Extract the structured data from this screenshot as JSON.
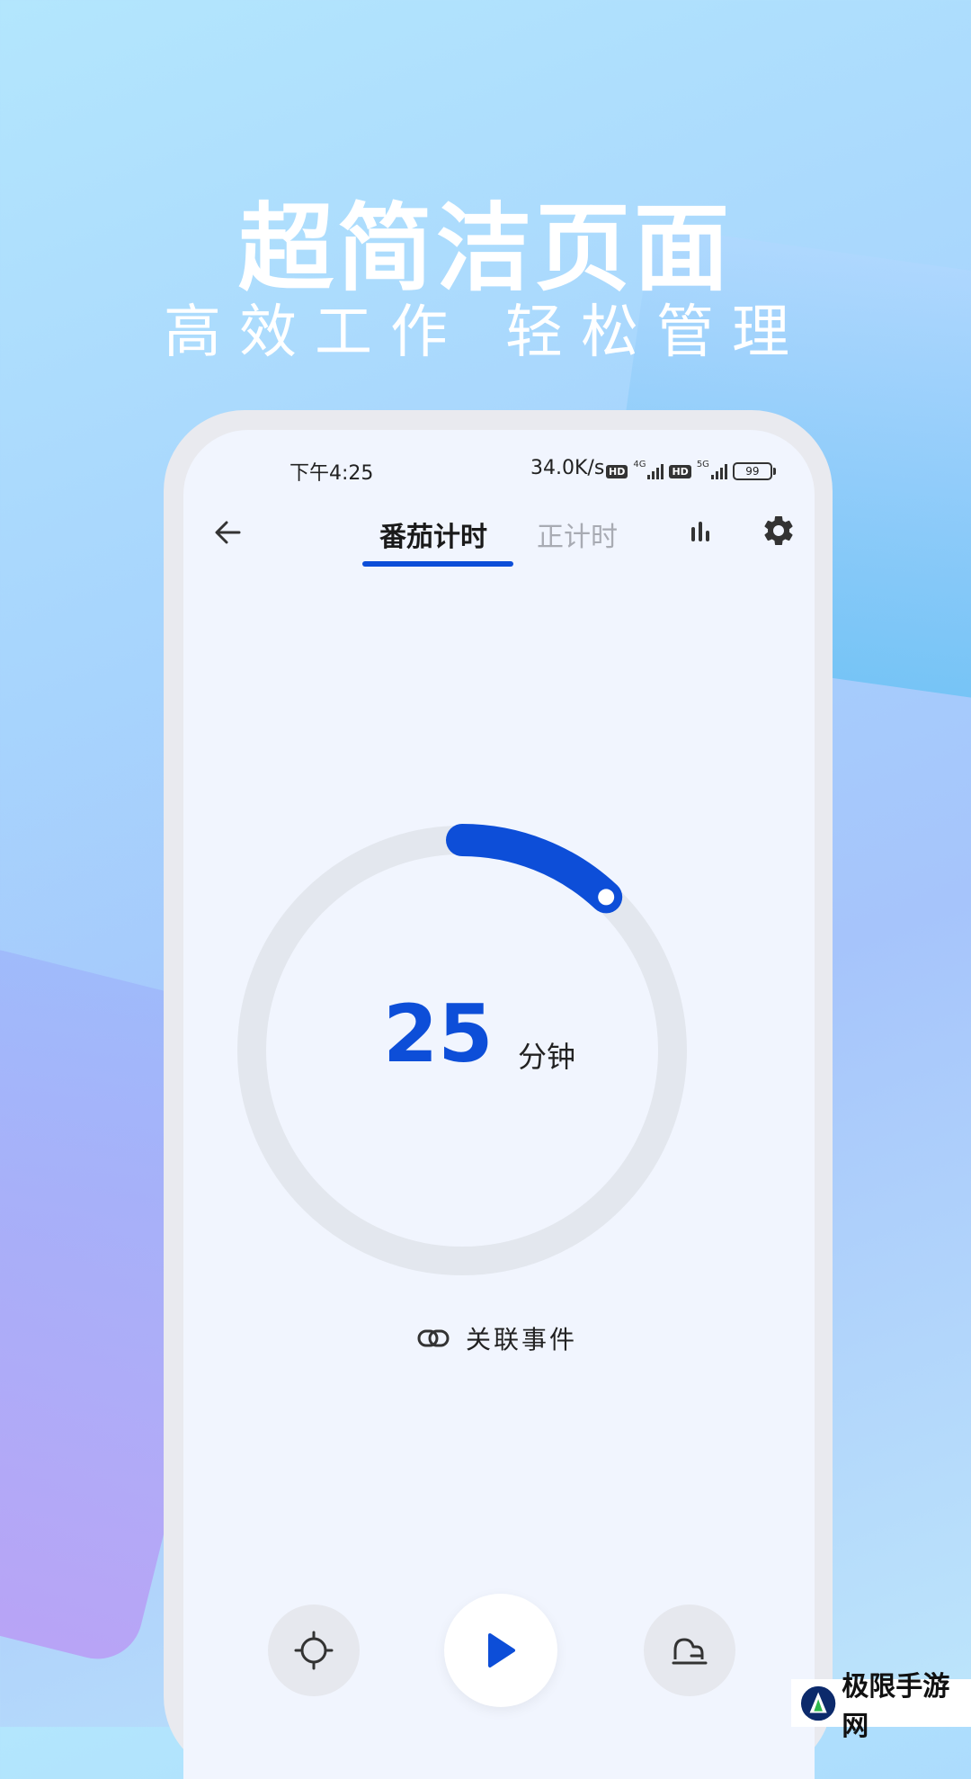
{
  "headline": {
    "title": "超简洁页面",
    "subtitle_left": "高效工作",
    "subtitle_right": "轻松管理"
  },
  "status_bar": {
    "time": "下午4:25",
    "speed": "34.0K/s",
    "badge_hd": "HD",
    "net_4g": "4G",
    "net_5g": "5G",
    "battery": "99"
  },
  "tabs": [
    {
      "label": "番茄计时",
      "active": true
    },
    {
      "label": "正计时",
      "active": false
    }
  ],
  "timer": {
    "value": "25",
    "unit": "分钟",
    "progress": 0.12,
    "accent": "#0d4ed8"
  },
  "link_event": {
    "label": "关联事件"
  },
  "watermark": {
    "text": "极限手游网"
  }
}
